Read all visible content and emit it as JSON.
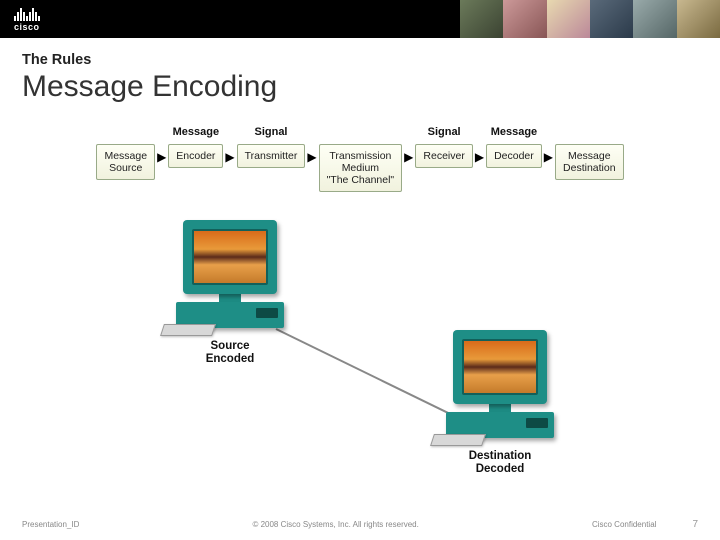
{
  "header": {
    "brand": "cisco"
  },
  "slide": {
    "subtitle": "The Rules",
    "title": "Message Encoding"
  },
  "chain": {
    "headers": {
      "message_left": "Message",
      "signal_left": "Signal",
      "signal_right": "Signal",
      "message_right": "Message"
    },
    "boxes": {
      "source": "Message\nSource",
      "encoder": "Encoder",
      "transmitter": "Transmitter",
      "medium": "Transmission\nMedium\n\"The Channel\"",
      "receiver": "Receiver",
      "decoder": "Decoder",
      "destination": "Message\nDestination"
    }
  },
  "scene": {
    "source_label": "Source\nEncoded",
    "dest_label": "Destination\nDecoded"
  },
  "footer": {
    "left": "Presentation_ID",
    "mid": "© 2008 Cisco Systems, Inc. All rights reserved.",
    "conf": "Cisco Confidential",
    "page": "7"
  }
}
